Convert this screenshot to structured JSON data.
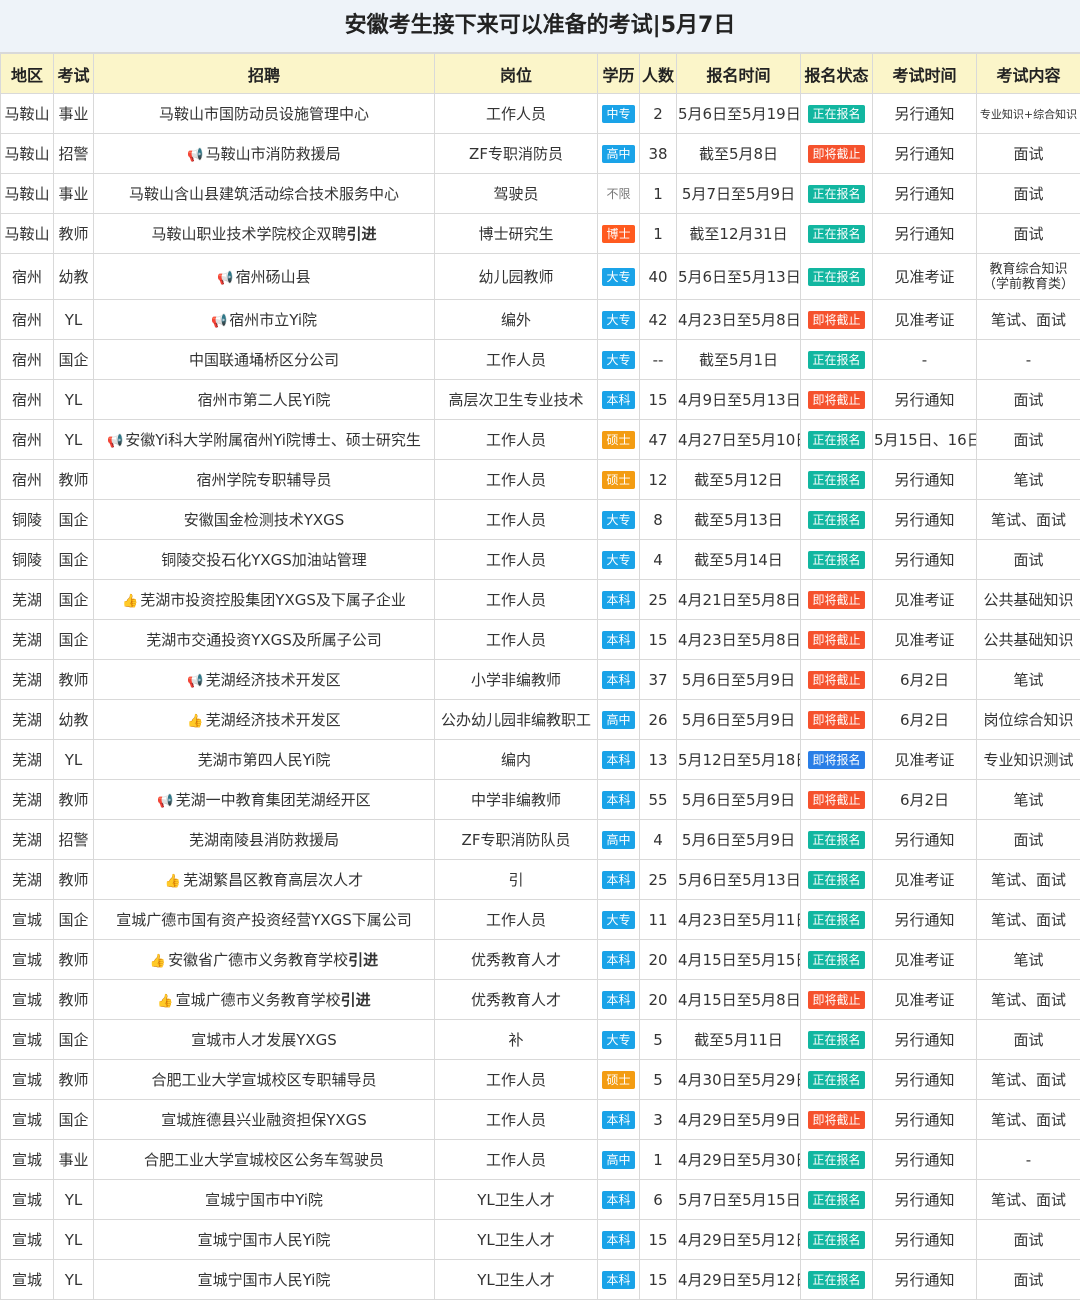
{
  "title": "安徽考生接下来可以准备的考试|5月7日",
  "headers": [
    "地区",
    "考试",
    "招聘",
    "岗位",
    "学历",
    "人数",
    "报名时间",
    "报名状态",
    "考试时间",
    "考试内容"
  ],
  "colors": {
    "header_bg": "#fbf5c9",
    "title_bg": "#eef3f9",
    "edu": {
      "中专": "#1aa3e8",
      "高中": "#1aa3e8",
      "大专": "#1aa3e8",
      "本科": "#1aa3e8",
      "硕士": "#f39c12",
      "博士": "#ff5a1f",
      "不限": "transparent"
    },
    "status": {
      "正在报名": "#12b6a0",
      "即将截止": "#f5522d",
      "即将报名": "#2a7ee6"
    }
  },
  "rows": [
    {
      "region": "马鞍山",
      "type": "事业",
      "org": "马鞍山市国防动员设施管理中心",
      "org_icon": "",
      "org_bold": "",
      "post": "工作人员",
      "edu": "中专",
      "count": "2",
      "reg": "5月6日至5月19日",
      "status": "正在报名",
      "exam": "另行通知",
      "content": "专业知识+综合知识"
    },
    {
      "region": "马鞍山",
      "type": "招警",
      "org": "马鞍山市消防救援局",
      "org_icon": "megaphone-icon",
      "org_bold": "",
      "post": "ZF专职消防员",
      "edu": "高中",
      "count": "38",
      "reg": "截至5月8日",
      "status": "即将截止",
      "exam": "另行通知",
      "content": "面试"
    },
    {
      "region": "马鞍山",
      "type": "事业",
      "org": "马鞍山含山县建筑活动综合技术服务中心",
      "org_icon": "",
      "org_bold": "",
      "post": "驾驶员",
      "edu": "不限",
      "count": "1",
      "reg": "5月7日至5月9日",
      "status": "正在报名",
      "exam": "另行通知",
      "content": "面试"
    },
    {
      "region": "马鞍山",
      "type": "教师",
      "org": "马鞍山职业技术学院校企双聘",
      "org_icon": "",
      "org_bold": "引进",
      "post": "博士研究生",
      "edu": "博士",
      "count": "1",
      "reg": "截至12月31日",
      "status": "正在报名",
      "exam": "另行通知",
      "content": "面试"
    },
    {
      "region": "宿州",
      "type": "幼教",
      "org": "宿州砀山县",
      "org_icon": "megaphone-icon",
      "org_bold": "",
      "post": "幼儿园教师",
      "edu": "大专",
      "count": "40",
      "reg": "5月6日至5月13日",
      "status": "正在报名",
      "exam": "见准考证",
      "content": "教育综合知识（学前教育类）"
    },
    {
      "region": "宿州",
      "type": "YL",
      "org": "宿州市立Yi院",
      "org_icon": "megaphone-icon",
      "org_bold": "",
      "post": "编外",
      "edu": "大专",
      "count": "42",
      "reg": "4月23日至5月8日",
      "status": "即将截止",
      "exam": "见准考证",
      "content": "笔试、面试"
    },
    {
      "region": "宿州",
      "type": "国企",
      "org": "中国联通埇桥区分公司",
      "org_icon": "",
      "org_bold": "",
      "post": "工作人员",
      "edu": "大专",
      "count": "--",
      "reg": "截至5月1日",
      "status": "正在报名",
      "exam": "-",
      "content": "-"
    },
    {
      "region": "宿州",
      "type": "YL",
      "org": "宿州市第二人民Yi院",
      "org_icon": "",
      "org_bold": "",
      "post": "高层次卫生专业技术",
      "edu": "本科",
      "count": "15",
      "reg": "4月9日至5月13日",
      "status": "即将截止",
      "exam": "另行通知",
      "content": "面试"
    },
    {
      "region": "宿州",
      "type": "YL",
      "org": "安徽Yi科大学附属宿州Yi院博士、硕士研究生",
      "org_icon": "megaphone-icon",
      "org_bold": "",
      "post": "工作人员",
      "edu": "硕士",
      "count": "47",
      "reg": "4月27日至5月10日",
      "status": "正在报名",
      "exam": "5月15日、16日",
      "content": "面试"
    },
    {
      "region": "宿州",
      "type": "教师",
      "org": "宿州学院专职辅导员",
      "org_icon": "",
      "org_bold": "",
      "post": "工作人员",
      "edu": "硕士",
      "count": "12",
      "reg": "截至5月12日",
      "status": "正在报名",
      "exam": "另行通知",
      "content": "笔试"
    },
    {
      "region": "铜陵",
      "type": "国企",
      "org": "安徽国金检测技术YXGS",
      "org_icon": "",
      "org_bold": "",
      "post": "工作人员",
      "edu": "大专",
      "count": "8",
      "reg": "截至5月13日",
      "status": "正在报名",
      "exam": "另行通知",
      "content": "笔试、面试"
    },
    {
      "region": "铜陵",
      "type": "国企",
      "org": "铜陵交投石化YXGS加油站管理",
      "org_icon": "",
      "org_bold": "",
      "post": "工作人员",
      "edu": "大专",
      "count": "4",
      "reg": "截至5月14日",
      "status": "正在报名",
      "exam": "另行通知",
      "content": "面试"
    },
    {
      "region": "芜湖",
      "type": "国企",
      "org": "芜湖市投资控股集团YXGS及下属子企业",
      "org_icon": "thumbs-up-icon",
      "org_bold": "",
      "post": "工作人员",
      "edu": "本科",
      "count": "25",
      "reg": "4月21日至5月8日",
      "status": "即将截止",
      "exam": "见准考证",
      "content": "公共基础知识"
    },
    {
      "region": "芜湖",
      "type": "国企",
      "org": "芜湖市交通投资YXGS及所属子公司",
      "org_icon": "",
      "org_bold": "",
      "post": "工作人员",
      "edu": "本科",
      "count": "15",
      "reg": "4月23日至5月8日",
      "status": "即将截止",
      "exam": "见准考证",
      "content": "公共基础知识"
    },
    {
      "region": "芜湖",
      "type": "教师",
      "org": "芜湖经济技术开发区",
      "org_icon": "megaphone-icon",
      "org_bold": "",
      "post": "小学非编教师",
      "edu": "本科",
      "count": "37",
      "reg": "5月6日至5月9日",
      "status": "即将截止",
      "exam": "6月2日",
      "content": "笔试"
    },
    {
      "region": "芜湖",
      "type": "幼教",
      "org": "芜湖经济技术开发区",
      "org_icon": "thumbs-up-icon",
      "org_bold": "",
      "post": "公办幼儿园非编教职工",
      "edu": "高中",
      "count": "26",
      "reg": "5月6日至5月9日",
      "status": "即将截止",
      "exam": "6月2日",
      "content": "岗位综合知识"
    },
    {
      "region": "芜湖",
      "type": "YL",
      "org": "芜湖市第四人民Yi院",
      "org_icon": "",
      "org_bold": "",
      "post": "编内",
      "edu": "本科",
      "count": "13",
      "reg": "5月12日至5月18日",
      "status": "即将报名",
      "exam": "见准考证",
      "content": "专业知识测试"
    },
    {
      "region": "芜湖",
      "type": "教师",
      "org": "芜湖一中教育集团芜湖经开区",
      "org_icon": "megaphone-icon",
      "org_bold": "",
      "post": "中学非编教师",
      "edu": "本科",
      "count": "55",
      "reg": "5月6日至5月9日",
      "status": "即将截止",
      "exam": "6月2日",
      "content": "笔试"
    },
    {
      "region": "芜湖",
      "type": "招警",
      "org": "芜湖南陵县消防救援局",
      "org_icon": "",
      "org_bold": "",
      "post": "ZF专职消防队员",
      "edu": "高中",
      "count": "4",
      "reg": "5月6日至5月9日",
      "status": "正在报名",
      "exam": "另行通知",
      "content": "面试"
    },
    {
      "region": "芜湖",
      "type": "教师",
      "org": "芜湖繁昌区教育高层次人才",
      "org_icon": "thumbs-up-icon",
      "org_bold": "",
      "post": "引",
      "edu": "本科",
      "count": "25",
      "reg": "5月6日至5月13日",
      "status": "正在报名",
      "exam": "见准考证",
      "content": "笔试、面试"
    },
    {
      "region": "宣城",
      "type": "国企",
      "org": "宣城广德市国有资产投资经营YXGS下属公司",
      "org_icon": "",
      "org_bold": "",
      "post": "工作人员",
      "edu": "大专",
      "count": "11",
      "reg": "4月23日至5月11日",
      "status": "正在报名",
      "exam": "另行通知",
      "content": "笔试、面试"
    },
    {
      "region": "宣城",
      "type": "教师",
      "org": "安徽省广德市义务教育学校",
      "org_icon": "thumbs-up-icon",
      "org_bold": "引进",
      "post": "优秀教育人才",
      "edu": "本科",
      "count": "20",
      "reg": "4月15日至5月15日",
      "status": "正在报名",
      "exam": "见准考证",
      "content": "笔试"
    },
    {
      "region": "宣城",
      "type": "教师",
      "org": "宣城广德市义务教育学校",
      "org_icon": "thumbs-up-icon",
      "org_bold": "引进",
      "post": "优秀教育人才",
      "edu": "本科",
      "count": "20",
      "reg": "4月15日至5月8日",
      "status": "即将截止",
      "exam": "见准考证",
      "content": "笔试、面试"
    },
    {
      "region": "宣城",
      "type": "国企",
      "org": "宣城市人才发展YXGS",
      "org_icon": "",
      "org_bold": "",
      "post": "补",
      "edu": "大专",
      "count": "5",
      "reg": "截至5月11日",
      "status": "正在报名",
      "exam": "另行通知",
      "content": "面试"
    },
    {
      "region": "宣城",
      "type": "教师",
      "org": "合肥工业大学宣城校区专职辅导员",
      "org_icon": "",
      "org_bold": "",
      "post": "工作人员",
      "edu": "硕士",
      "count": "5",
      "reg": "4月30日至5月29日",
      "status": "正在报名",
      "exam": "另行通知",
      "content": "笔试、面试"
    },
    {
      "region": "宣城",
      "type": "国企",
      "org": "宣城旌德县兴业融资担保YXGS",
      "org_icon": "",
      "org_bold": "",
      "post": "工作人员",
      "edu": "本科",
      "count": "3",
      "reg": "4月29日至5月9日",
      "status": "即将截止",
      "exam": "另行通知",
      "content": "笔试、面试"
    },
    {
      "region": "宣城",
      "type": "事业",
      "org": "合肥工业大学宣城校区公务车驾驶员",
      "org_icon": "",
      "org_bold": "",
      "post": "工作人员",
      "edu": "高中",
      "count": "1",
      "reg": "4月29日至5月30日",
      "status": "正在报名",
      "exam": "另行通知",
      "content": "-"
    },
    {
      "region": "宣城",
      "type": "YL",
      "org": "宣城宁国市中Yi院",
      "org_icon": "",
      "org_bold": "",
      "post": "YL卫生人才",
      "edu": "本科",
      "count": "6",
      "reg": "5月7日至5月15日",
      "status": "正在报名",
      "exam": "另行通知",
      "content": "笔试、面试"
    },
    {
      "region": "宣城",
      "type": "YL",
      "org": "宣城宁国市人民Yi院",
      "org_icon": "",
      "org_bold": "",
      "post": "YL卫生人才",
      "edu": "本科",
      "count": "15",
      "reg": "4月29日至5月12日",
      "status": "正在报名",
      "exam": "另行通知",
      "content": "面试"
    },
    {
      "region": "宣城",
      "type": "YL",
      "org": "宣城宁国市人民Yi院",
      "org_icon": "",
      "org_bold": "",
      "post": "YL卫生人才",
      "edu": "本科",
      "count": "15",
      "reg": "4月29日至5月12日",
      "status": "正在报名",
      "exam": "另行通知",
      "content": "面试"
    }
  ]
}
